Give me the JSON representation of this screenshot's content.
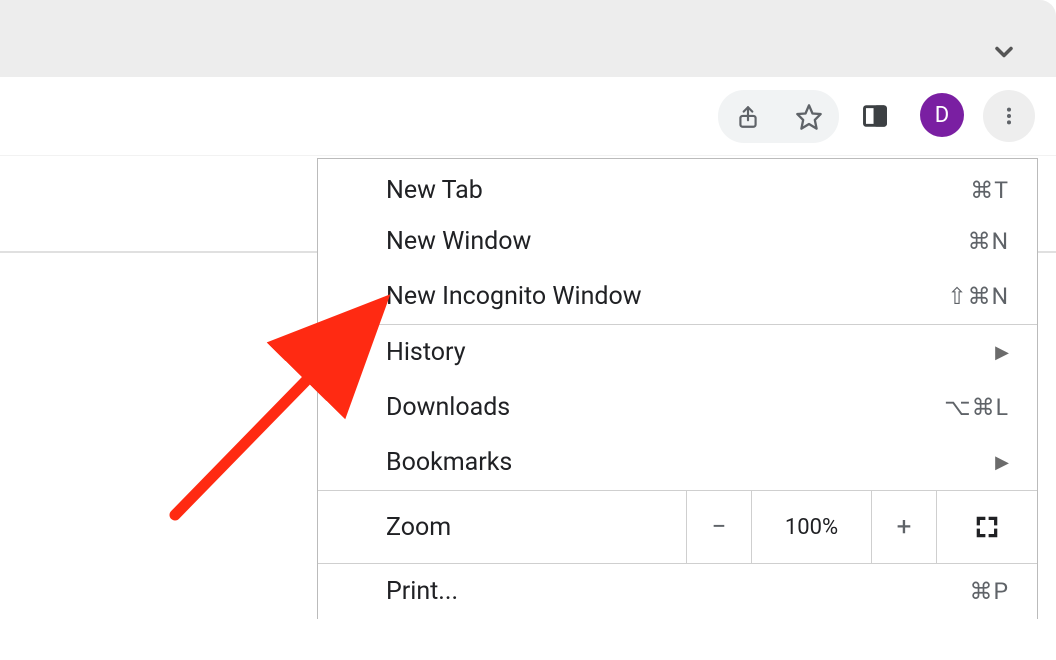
{
  "avatar": {
    "letter": "D",
    "color": "#7a1fa2"
  },
  "menu": {
    "new_tab": {
      "label": "New Tab",
      "shortcut": "⌘T"
    },
    "new_window": {
      "label": "New Window",
      "shortcut": "⌘N"
    },
    "new_incognito": {
      "label": "New Incognito Window",
      "shortcut": "⇧⌘N"
    },
    "history": {
      "label": "History"
    },
    "downloads": {
      "label": "Downloads",
      "shortcut": "⌥⌘L"
    },
    "bookmarks": {
      "label": "Bookmarks"
    },
    "zoom": {
      "label": "Zoom",
      "value": "100%",
      "minus": "−",
      "plus": "+"
    },
    "print": {
      "label": "Print...",
      "shortcut": "⌘P"
    }
  }
}
